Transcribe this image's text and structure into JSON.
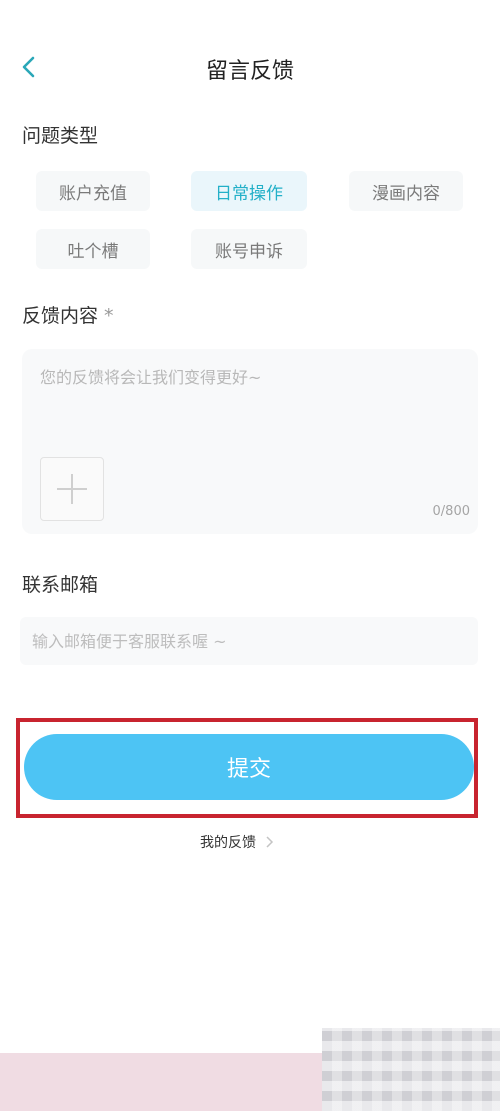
{
  "header": {
    "title": "留言反馈"
  },
  "issue_type": {
    "title": "问题类型",
    "chips": [
      {
        "label": "账户充值",
        "selected": false
      },
      {
        "label": "日常操作",
        "selected": true
      },
      {
        "label": "漫画内容",
        "selected": false
      },
      {
        "label": "吐个槽",
        "selected": false
      },
      {
        "label": "账号申诉",
        "selected": false
      }
    ]
  },
  "feedback": {
    "title": "反馈内容",
    "required_mark": "*",
    "placeholder": "您的反馈将会让我们变得更好~",
    "counter": "0/800"
  },
  "email": {
    "title": "联系邮箱",
    "placeholder": "输入邮箱便于客服联系喔 ~"
  },
  "submit": {
    "label": "提交"
  },
  "my_feedback": {
    "label": "我的反馈"
  },
  "colors": {
    "accent": "#4dc4f4",
    "active_chip_text": "#23b0c8",
    "highlight_border": "#c8242f"
  }
}
